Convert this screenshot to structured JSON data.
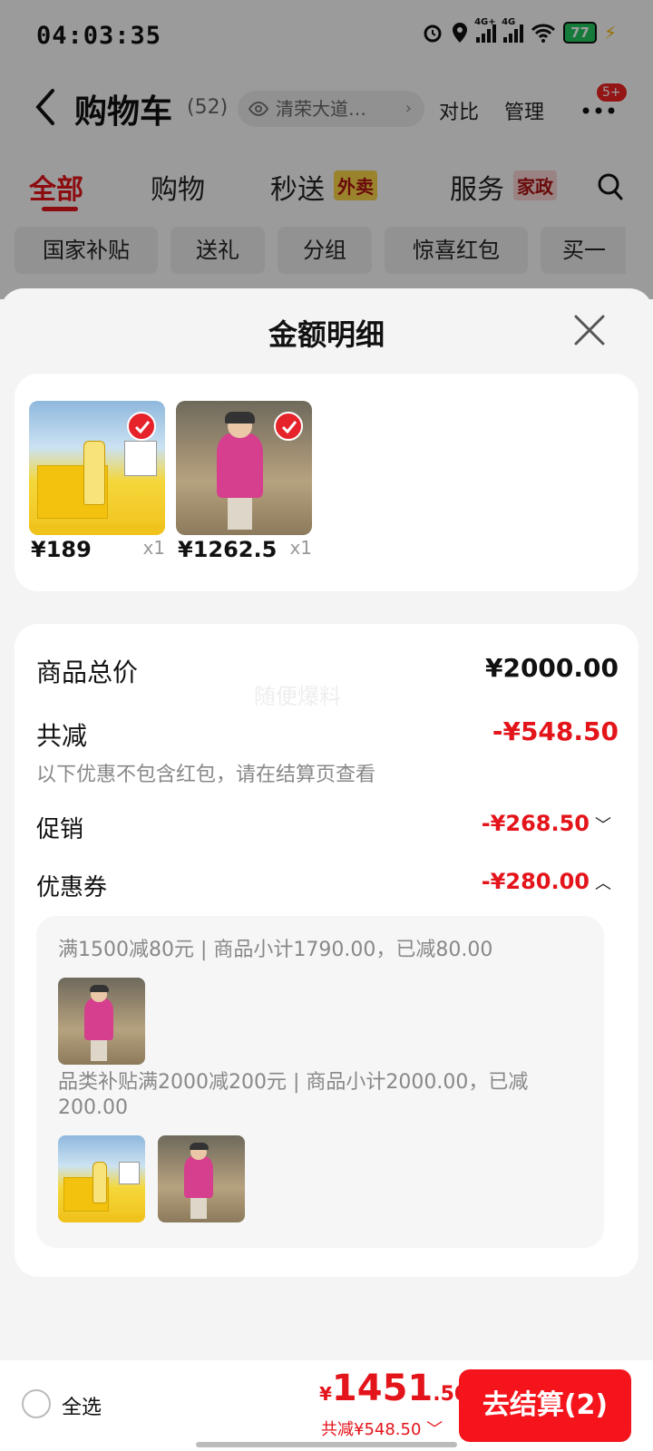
{
  "status_bar": {
    "time": "04:03:35",
    "net1": "4G+",
    "net2": "4G",
    "battery": "77"
  },
  "nav": {
    "title": "购物车",
    "count": "(52)",
    "address": "清荣大道…",
    "compare": "对比",
    "manage": "管理",
    "more_badge": "5+"
  },
  "tabs": {
    "all": "全部",
    "shopping": "购物",
    "express": "秒送",
    "express_tag": "外卖",
    "service": "服务",
    "service_tag": "家政"
  },
  "chips": [
    "国家补贴",
    "送礼",
    "分组",
    "惊喜红包",
    "买一"
  ],
  "sheet": {
    "title": "金额明细",
    "items": [
      {
        "price": "¥189",
        "qty": "x1"
      },
      {
        "price": "¥1262.5",
        "qty": "x1"
      }
    ],
    "watermark": "随便爆料",
    "total_label": "商品总价",
    "total_value": "¥2000.00",
    "reduced_label": "共减",
    "reduced_value": "-¥548.50",
    "reduced_note": "以下优惠不包含红包，请在结算页查看",
    "promo_label": "促销",
    "promo_value": "-¥268.50",
    "coupon_label": "优惠券",
    "coupon_value": "-¥280.00",
    "coupon_lines": [
      "满1500减80元 | 商品小计1790.00，已减80.00",
      "品类补贴满2000减200元 | 商品小计2000.00，已减200.00"
    ]
  },
  "bottom": {
    "select_all": "全选",
    "total_yen": "¥",
    "total_int": "1451",
    "total_dec": ".50",
    "saved": "共减¥548.50",
    "checkout": "去结算(2)"
  },
  "colors": {
    "accent": "#e4141b",
    "checkout_bg": "#f5141b"
  }
}
